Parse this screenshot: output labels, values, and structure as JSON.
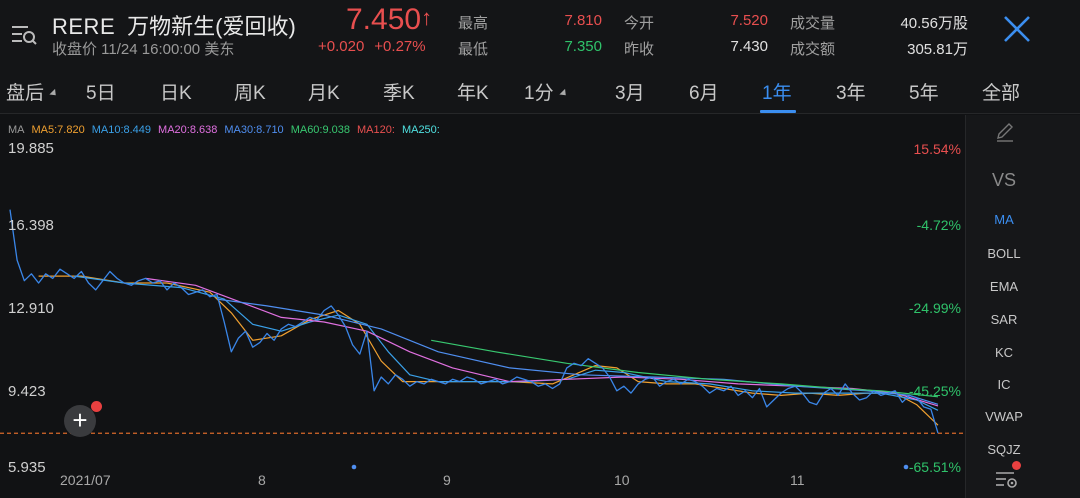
{
  "header": {
    "code": "RERE",
    "name": "万物新生(爱回收)",
    "status": "收盘价 11/24 16:00:00 美东",
    "price": "7.450",
    "price_arrow": "↑",
    "change": "+0.020",
    "change_pct": "+0.27%",
    "stats": [
      {
        "label": "最高",
        "value": "7.810",
        "color": "#e84f4f"
      },
      {
        "label": "最低",
        "value": "7.350",
        "color": "#2fc26a"
      },
      {
        "label": "今开",
        "value": "7.520",
        "color": "#e84f4f"
      },
      {
        "label": "昨收",
        "value": "7.430",
        "color": "#e0e0e0"
      },
      {
        "label": "成交量",
        "value": "40.56万股",
        "color": "#e0e0e0"
      },
      {
        "label": "成交额",
        "value": "305.81万",
        "color": "#e0e0e0"
      }
    ],
    "icons": {
      "menu": "menu-search-icon",
      "close": "close-icon"
    }
  },
  "tabs": [
    {
      "label": "盘后",
      "dropdown": true
    },
    {
      "label": "5日"
    },
    {
      "label": "日K"
    },
    {
      "label": "周K"
    },
    {
      "label": "月K"
    },
    {
      "label": "季K"
    },
    {
      "label": "年K"
    },
    {
      "label": "1分",
      "dropdown": true
    },
    {
      "label": "3月"
    },
    {
      "label": "6月"
    },
    {
      "label": "1年",
      "active": true
    },
    {
      "label": "3年"
    },
    {
      "label": "5年"
    },
    {
      "label": "全部"
    }
  ],
  "ma_legend": [
    {
      "text": "MA",
      "color": "#9a9a9a"
    },
    {
      "text": "MA5:7.820",
      "color": "#f0a030"
    },
    {
      "text": "MA10:8.449",
      "color": "#3aa0e8"
    },
    {
      "text": "MA20:8.638",
      "color": "#e070e0"
    },
    {
      "text": "MA30:8.710",
      "color": "#4f8ef0"
    },
    {
      "text": "MA60:9.038",
      "color": "#38c870"
    },
    {
      "text": "MA120:",
      "color": "#e85050"
    },
    {
      "text": "MA250:",
      "color": "#50e0e0"
    }
  ],
  "chart_data": {
    "type": "line",
    "y_labels": [
      "19.885",
      "16.398",
      "12.910",
      "9.423",
      "5.935"
    ],
    "pct_labels": [
      {
        "text": "15.54%",
        "color": "#e84f4f"
      },
      {
        "text": "-4.72%",
        "color": "#2fc26a"
      },
      {
        "text": "-24.99%",
        "color": "#2fc26a"
      },
      {
        "text": "-45.25%",
        "color": "#2fc26a"
      },
      {
        "text": "-65.51%",
        "color": "#2fc26a"
      }
    ],
    "x_labels": [
      "2021/07",
      "8",
      "9",
      "10",
      "11"
    ],
    "ylim": [
      5.935,
      19.885
    ],
    "reference_price": 7.45,
    "xlim": [
      0,
      130
    ],
    "series": [
      {
        "name": "price",
        "color": "#3a86e8",
        "x": [
          0,
          1,
          2,
          3,
          4,
          5,
          6,
          7,
          8,
          9,
          10,
          11,
          12,
          13,
          14,
          15,
          16,
          17,
          18,
          19,
          20,
          21,
          22,
          23,
          24,
          25,
          26,
          27,
          28,
          29,
          30,
          31,
          32,
          33,
          34,
          35,
          36,
          37,
          38,
          39,
          40,
          41,
          42,
          43,
          44,
          45,
          46,
          47,
          48,
          49,
          50,
          51,
          52,
          53,
          54,
          55,
          56,
          57,
          58,
          59,
          60,
          61,
          62,
          63,
          64,
          65,
          66,
          67,
          68,
          69,
          70,
          71,
          72,
          73,
          74,
          75,
          76,
          77,
          78,
          79,
          80,
          81,
          82,
          83,
          84,
          85,
          86,
          87,
          88,
          89,
          90,
          91,
          92,
          93,
          94,
          95,
          96,
          97,
          98,
          99,
          100,
          101,
          102,
          103,
          104,
          105,
          106,
          107,
          108,
          109,
          110,
          111,
          112,
          113,
          114,
          115,
          116,
          117,
          118,
          119,
          120,
          121,
          122,
          123,
          124,
          125,
          126,
          127,
          128,
          129,
          130
        ],
        "values": [
          17.2,
          15.0,
          14.1,
          14.4,
          14.0,
          14.4,
          14.2,
          14.6,
          14.4,
          14.2,
          14.5,
          14.0,
          13.7,
          14.1,
          14.5,
          14.2,
          14.0,
          13.9,
          14.1,
          14.2,
          14.0,
          14.1,
          13.7,
          14.0,
          13.8,
          13.5,
          13.6,
          13.7,
          13.4,
          13.5,
          12.3,
          11.0,
          11.6,
          11.9,
          11.2,
          11.4,
          11.8,
          11.5,
          12.0,
          12.2,
          12.1,
          12.3,
          12.5,
          12.4,
          12.8,
          13.0,
          12.6,
          12.1,
          11.3,
          10.9,
          11.9,
          9.3,
          9.9,
          9.6,
          10.0,
          9.8,
          9.5,
          9.7,
          9.6,
          9.8,
          9.7,
          9.6,
          9.8,
          9.7,
          9.9,
          9.8,
          9.6,
          9.7,
          9.8,
          9.6,
          9.7,
          9.9,
          9.8,
          9.7,
          9.5,
          9.6,
          9.4,
          9.6,
          10.3,
          10.5,
          10.4,
          10.7,
          10.5,
          10.3,
          9.9,
          9.3,
          9.5,
          9.2,
          9.6,
          9.8,
          9.9,
          9.5,
          9.7,
          9.8,
          9.6,
          9.8,
          9.7,
          9.5,
          9.2,
          9.4,
          9.3,
          9.5,
          9.1,
          9.3,
          9.0,
          9.4,
          8.6,
          8.9,
          9.2,
          9.4,
          9.5,
          9.2,
          8.8,
          8.7,
          9.2,
          9.4,
          9.1,
          9.6,
          9.2,
          8.9,
          9.0,
          9.3,
          9.1,
          9.2,
          9.3,
          8.8,
          9.1,
          9.0,
          8.6,
          8.5,
          7.45
        ]
      },
      {
        "name": "MA5",
        "color": "#f0a030",
        "x": [
          4,
          10,
          16,
          22,
          28,
          31,
          34,
          38,
          42,
          46,
          49,
          52,
          55,
          58,
          64,
          70,
          76,
          79,
          82,
          85,
          88,
          92,
          96,
          100,
          104,
          108,
          112,
          116,
          120,
          124,
          127,
          130
        ],
        "values": [
          14.3,
          14.3,
          14.0,
          14.0,
          13.6,
          12.7,
          11.5,
          11.7,
          12.4,
          12.8,
          12.2,
          10.6,
          9.7,
          9.7,
          9.7,
          9.7,
          9.6,
          10.0,
          10.4,
          10.3,
          9.7,
          9.6,
          9.6,
          9.4,
          9.2,
          9.1,
          9.2,
          9.1,
          9.2,
          9.2,
          8.7,
          7.8
        ]
      },
      {
        "name": "MA10",
        "color": "#3aa0e8",
        "x": [
          9,
          16,
          24,
          30,
          34,
          38,
          42,
          46,
          50,
          53,
          56,
          60,
          66,
          72,
          78,
          82,
          86,
          92,
          98,
          104,
          110,
          116,
          122,
          127,
          130
        ],
        "values": [
          14.3,
          14.0,
          13.8,
          13.3,
          12.2,
          11.9,
          12.3,
          12.6,
          12.2,
          11.0,
          10.0,
          9.7,
          9.7,
          9.7,
          9.8,
          10.2,
          10.1,
          9.7,
          9.6,
          9.3,
          9.2,
          9.2,
          9.2,
          8.9,
          8.45
        ]
      },
      {
        "name": "MA20",
        "color": "#e070e0",
        "x": [
          19,
          26,
          32,
          38,
          44,
          50,
          56,
          62,
          70,
          78,
          86,
          94,
          102,
          110,
          118,
          124,
          130
        ],
        "values": [
          14.2,
          13.9,
          13.2,
          12.5,
          12.3,
          11.9,
          11.0,
          10.3,
          9.7,
          9.8,
          9.9,
          9.8,
          9.6,
          9.5,
          9.4,
          9.2,
          8.64
        ]
      },
      {
        "name": "MA30",
        "color": "#4f8ef0",
        "x": [
          29,
          36,
          44,
          52,
          60,
          70,
          80,
          90,
          100,
          110,
          120,
          126,
          130
        ],
        "values": [
          13.3,
          13.0,
          12.6,
          12.0,
          11.0,
          10.3,
          10.0,
          9.9,
          9.8,
          9.5,
          9.3,
          9.1,
          8.71
        ]
      },
      {
        "name": "MA60",
        "color": "#38c870",
        "x": [
          59,
          68,
          78,
          88,
          98,
          108,
          116,
          122,
          130
        ],
        "values": [
          11.5,
          11.0,
          10.5,
          10.1,
          9.8,
          9.6,
          9.4,
          9.3,
          9.04
        ]
      }
    ]
  },
  "side_panel": {
    "items": [
      "VS",
      "MA",
      "BOLL",
      "EMA",
      "SAR",
      "KC",
      "IC",
      "VWAP",
      "SQJZ"
    ],
    "active": "MA",
    "icons": {
      "top": "pencil-icon",
      "bottom": "settings-icon"
    }
  }
}
